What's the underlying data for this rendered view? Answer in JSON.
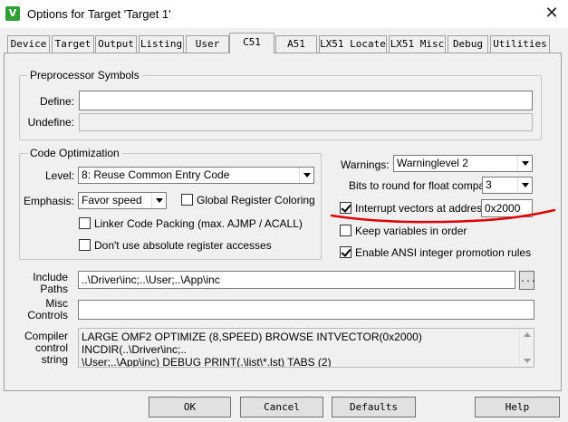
{
  "window": {
    "title": "Options for Target 'Target 1'",
    "app_icon_glyph": "V",
    "accent_color": "#2f9e35"
  },
  "tabs": [
    {
      "label": "Device"
    },
    {
      "label": "Target"
    },
    {
      "label": "Output"
    },
    {
      "label": "Listing"
    },
    {
      "label": "User"
    },
    {
      "label": "C51",
      "active": true
    },
    {
      "label": "A51"
    },
    {
      "label": "LX51 Locate"
    },
    {
      "label": "LX51 Misc"
    },
    {
      "label": "Debug"
    },
    {
      "label": "Utilities"
    }
  ],
  "preprocessor": {
    "title": "Preprocessor Symbols",
    "define_label": "Define:",
    "define_value": "",
    "undefine_label": "Undefine:",
    "undefine_value": ""
  },
  "code_optimization": {
    "title": "Code Optimization",
    "level_label": "Level:",
    "level_value": "8: Reuse Common Entry Code",
    "emphasis_label": "Emphasis:",
    "emphasis_value": "Favor speed",
    "global_register_coloring": {
      "label": "Global Register Coloring",
      "checked": false
    },
    "linker_code_packing": {
      "label": "Linker Code Packing (max. AJMP / ACALL)",
      "checked": false
    },
    "no_absolute_register": {
      "label": "Don't use absolute register accesses",
      "checked": false
    }
  },
  "right_options": {
    "warnings_label": "Warnings:",
    "warnings_value": "Warninglevel 2",
    "bits_label": "Bits to round for float compare:",
    "bits_value": "3",
    "interrupt_vectors": {
      "label": "Interrupt vectors at address:",
      "checked": true,
      "value": "0x2000"
    },
    "keep_variables": {
      "label": "Keep variables in order",
      "checked": false
    },
    "ansi_integer": {
      "label": "Enable ANSI integer promotion rules",
      "checked": true
    },
    "annotation_color": "#e00000"
  },
  "include_paths": {
    "label_line1": "Include",
    "label_line2": "Paths",
    "value": "..\\Driver\\inc;..\\User;..\\App\\inc",
    "browse_label": "..."
  },
  "misc_controls": {
    "label_line1": "Misc",
    "label_line2": "Controls",
    "value": ""
  },
  "compiler_control": {
    "label_line1": "Compiler",
    "label_line2": "control",
    "label_line3": "string",
    "line1": "LARGE OMF2 OPTIMIZE (8,SPEED) BROWSE INTVECTOR(0x2000) INCDIR(..\\Driver\\inc;..",
    "line2": "\\User;..\\App\\inc) DEBUG PRINT(.\\list\\*.lst) TABS (2)"
  },
  "buttons": {
    "ok": "OK",
    "cancel": "Cancel",
    "defaults": "Defaults",
    "help": "Help"
  }
}
